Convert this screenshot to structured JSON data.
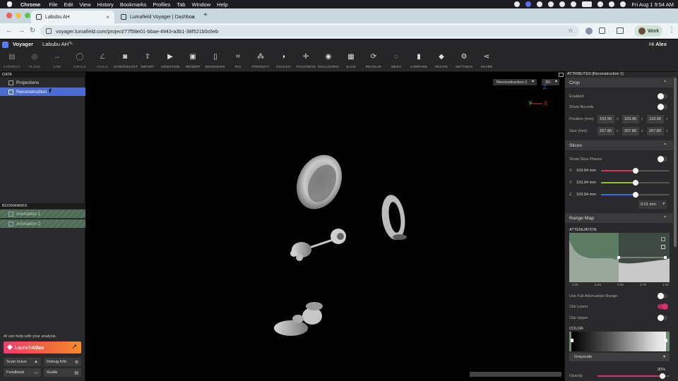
{
  "menubar": {
    "apple": "",
    "items": [
      "Chrome",
      "File",
      "Edit",
      "View",
      "History",
      "Bookmarks",
      "Profiles",
      "Tab",
      "Window",
      "Help"
    ],
    "datetime": "Fri Aug 1  9:54 AM"
  },
  "browser": {
    "tabs": [
      {
        "label": "Labubu AH",
        "active": true
      },
      {
        "label": "Lumafield Voyager | Dashboa",
        "active": false
      }
    ],
    "new_tab": "+",
    "url": "voyager.lumafield.com/project/77f58e01-bbae-4943-a3b1-38f521b0c6eb",
    "profile": "Work"
  },
  "app": {
    "name": "Voyager",
    "project": "Labubu AH",
    "greeting_prefix": "Hi ",
    "user": "Alex"
  },
  "toolbar": [
    {
      "label": "CORRECT",
      "icon": "correct-icon"
    },
    {
      "label": "PLANE",
      "icon": "plane-icon"
    },
    {
      "label": "LINE",
      "icon": "line-icon"
    },
    {
      "label": "CIRCLE",
      "icon": "circle-icon"
    },
    {
      "label": "ANGLE",
      "icon": "angle-icon"
    },
    {
      "label": "SCREENSHOT",
      "icon": "camera-icon"
    },
    {
      "label": "IMPORT",
      "icon": "import-icon"
    },
    {
      "label": "ANIMATION",
      "icon": "animation-icon"
    },
    {
      "label": "RENDER",
      "icon": "render-icon"
    },
    {
      "label": "BOOKMARK",
      "icon": "bookmark-icon"
    },
    {
      "label": "ROI",
      "icon": "roi-icon"
    },
    {
      "label": "POROSITY",
      "icon": "porosity-icon"
    },
    {
      "label": "CRACKS",
      "icon": "cracks-icon"
    },
    {
      "label": "THICKNESS",
      "icon": "thickness-icon"
    },
    {
      "label": "INCLUSIONS",
      "icon": "inclusions-icon"
    },
    {
      "label": "SLICE",
      "icon": "slice-icon"
    },
    {
      "label": "REVOLVE",
      "icon": "revolve-icon"
    },
    {
      "label": "MESH",
      "icon": "mesh-icon"
    },
    {
      "label": "COMPARE",
      "icon": "compare-icon"
    },
    {
      "label": "RECIPE",
      "icon": "recipe-icon"
    },
    {
      "label": "SETTINGS",
      "icon": "gear-icon"
    },
    {
      "label": "SHARE",
      "icon": "share-icon"
    }
  ],
  "left": {
    "data_header": "DATA",
    "items": [
      {
        "label": "Projections",
        "selected": false
      },
      {
        "label": "Reconstruction",
        "selected": true
      }
    ],
    "bookmarks_header": "BOOKMARKS",
    "bookmarks": [
      "Animation 1",
      "Animation 2"
    ],
    "ai_text": "AI can help with your analysis.",
    "launch_prefix": "Launch ",
    "launch_name": "Atlas",
    "buttons": [
      "Scan Issue",
      "Debug Info",
      "Feedback",
      "Guide"
    ]
  },
  "viewport": {
    "recon_select": "Reconstruction 1",
    "mode_select": "3D",
    "axes": {
      "y": "Y",
      "x": "X",
      "z": "Z"
    }
  },
  "right": {
    "header": "ATTRIBUTES [Reconstruction 1]",
    "crop": {
      "title": "Crop",
      "enabled_label": "Enabled",
      "enabled": false,
      "show_bounds_label": "Show Bounds",
      "show_bounds": false,
      "position_label": "Position (mm)",
      "position": [
        "103.90",
        "103.90",
        "103.90"
      ],
      "size_label": "Size (mm)",
      "size": [
        "207.80",
        "207.80",
        "207.80"
      ],
      "axes": [
        "x",
        "y",
        "z"
      ]
    },
    "slices": {
      "title": "Slices",
      "show_planes_label": "Show Slice Planes",
      "show_planes": false,
      "rows": [
        {
          "axis": "X",
          "value": "103.94 mm",
          "color": "#e0305a",
          "fraction": 0.5
        },
        {
          "axis": "Y",
          "value": "103.94 mm",
          "color": "#8fbf3a",
          "fraction": 0.5
        },
        {
          "axis": "Z",
          "value": "103.94 mm",
          "color": "#3c6fe0",
          "fraction": 0.5
        }
      ],
      "step": "0.01 mm"
    },
    "range_map": {
      "title": "Range Map",
      "attenuation_label": "ATTENUATION",
      "ticks": [
        "0.00",
        "0.25",
        "0.50",
        "0.75",
        "1.00"
      ],
      "full_range_label": "Use Full Attenuation Range",
      "full_range": false,
      "clip_lower_label": "Clip Lower",
      "clip_lower": true,
      "clip_upper_label": "Clip Upper",
      "clip_upper": false,
      "color_label": "COLOR",
      "colormap": "Grayscale",
      "opacity_value": "90%",
      "opacity_label": "Opacity",
      "opacity": 0.9,
      "accent": "#d6336c"
    }
  }
}
